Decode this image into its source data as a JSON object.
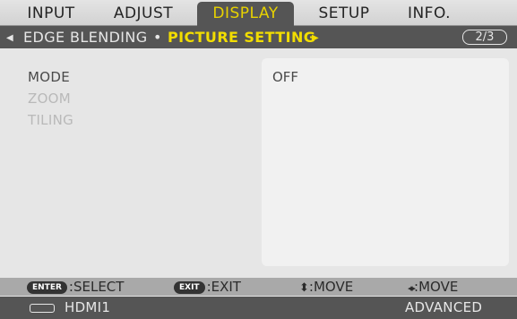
{
  "tabs": [
    {
      "label": "INPUT",
      "active": false
    },
    {
      "label": "ADJUST",
      "active": false
    },
    {
      "label": "DISPLAY",
      "active": true
    },
    {
      "label": "SETUP",
      "active": false
    },
    {
      "label": "INFO.",
      "active": false
    }
  ],
  "breadcrumb": {
    "left_arrow": "◀",
    "previous": "EDGE BLENDING",
    "separator": "•",
    "current": "PICTURE SETTING",
    "right_arrow": "▶",
    "page": "2/3"
  },
  "menu": {
    "items": [
      {
        "label": "MODE",
        "enabled": true
      },
      {
        "label": "ZOOM",
        "enabled": false
      },
      {
        "label": "TILING",
        "enabled": false
      }
    ],
    "value": "OFF"
  },
  "guide": {
    "enter_key": "ENTER",
    "enter_action": ":SELECT",
    "exit_key": "EXIT",
    "exit_action": ":EXIT",
    "updown_symbol": "⬍",
    "updown_action": ":MOVE",
    "leftright_symbol": "◂▸",
    "leftright_action": ":MOVE"
  },
  "status": {
    "input": "HDMI1",
    "input_icon": "hdmi-port-icon",
    "mode": "ADVANCED"
  },
  "colors": {
    "accent": "#f2dd00",
    "bar_dark": "#555555",
    "panel_bg": "#e6e6e6"
  }
}
